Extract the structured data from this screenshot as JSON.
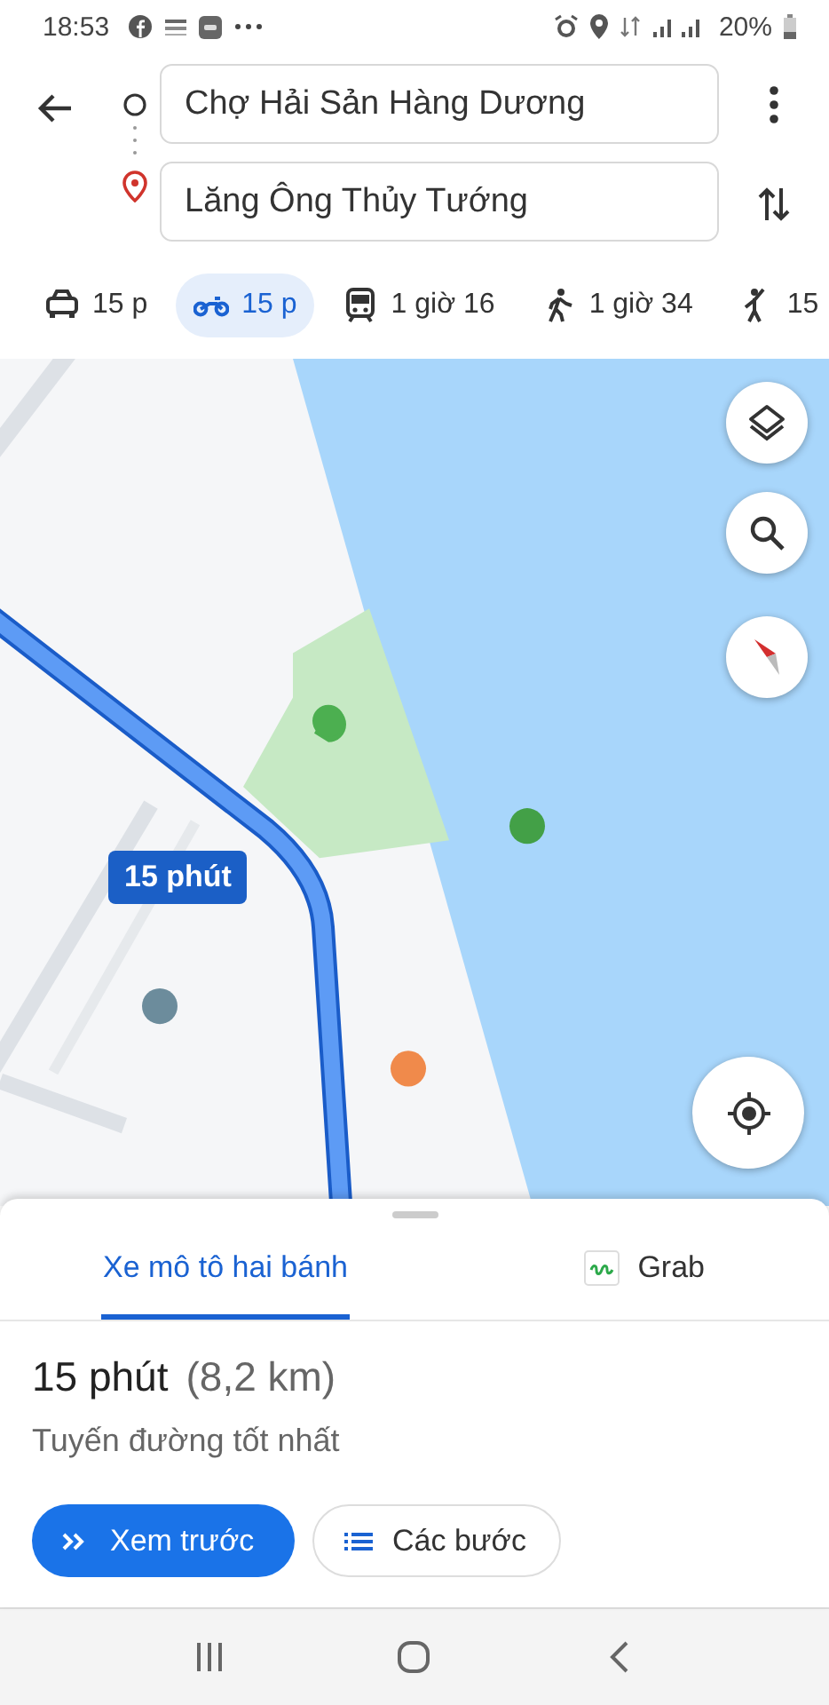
{
  "status_bar": {
    "time": "18:53",
    "battery": "20%"
  },
  "directions": {
    "origin": "Chợ Hải Sản Hàng Dương",
    "destination": "Lăng Ông Thủy Tướng"
  },
  "modes": [
    {
      "kind": "car",
      "label": "15 p",
      "selected": false
    },
    {
      "kind": "motorbike",
      "label": "15 p",
      "selected": true
    },
    {
      "kind": "transit",
      "label": "1 giờ 16",
      "selected": false
    },
    {
      "kind": "walk",
      "label": "1 giờ 34",
      "selected": false
    },
    {
      "kind": "ride",
      "label": "15",
      "selected": false
    }
  ],
  "map": {
    "kind": "picture",
    "route_badge": "15 phút"
  },
  "sheet": {
    "tabs": [
      {
        "kind": "motorbike",
        "label": "Xe mô tô hai bánh",
        "selected": true
      },
      {
        "kind": "grab",
        "label": "Grab",
        "selected": false
      }
    ],
    "duration": "15 phút",
    "distance": "(8,2 km)",
    "note": "Tuyến đường tốt nhất",
    "buttons": [
      {
        "kind": "primary",
        "label": "Xem trước"
      },
      {
        "kind": "secondary",
        "label": "Các bước"
      }
    ]
  }
}
